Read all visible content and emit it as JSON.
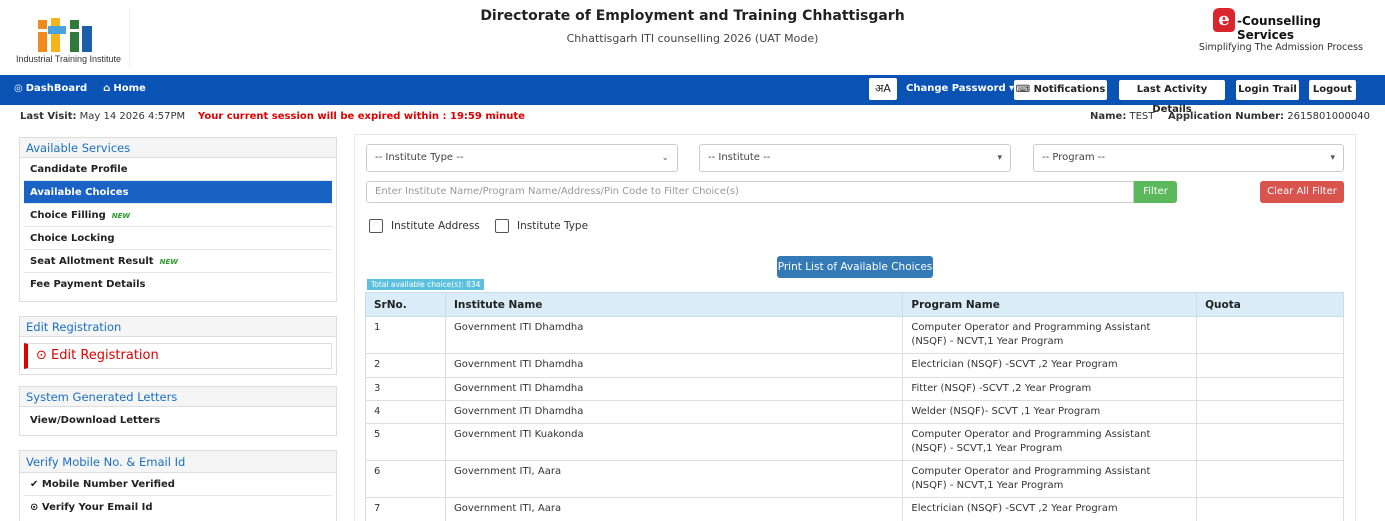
{
  "header": {
    "logo_text": "Industrial Training Institute",
    "title": "Directorate of Employment and Training Chhattisgarh",
    "subtitle": "Chhattisgarh ITI counselling 2026 (UAT Mode)",
    "brand_letter": "e",
    "brand_title": "-Counselling Services",
    "brand_tagline": "Simplifying The Admission Process"
  },
  "nav": {
    "dashboard": "DashBoard",
    "home": "Home",
    "lang": "अA",
    "change_password": "Change Password ▾",
    "notifications": "Notifications",
    "last_activity": "Last Activity Details",
    "login_trail": "Login Trail",
    "logout": "Logout"
  },
  "info": {
    "last_visit_label": "Last Visit:",
    "last_visit_value": " May 14 2026 4:57PM",
    "session_msg": "Your current session will be expired within : 19:59 minute",
    "name_label": "Name:",
    "name_value": " TEST",
    "app_label": "Application Number:",
    "app_value": " 2615801000040"
  },
  "sidebar": {
    "services_title": "Available Services",
    "services": [
      {
        "label": "Candidate Profile",
        "new": ""
      },
      {
        "label": "Available Choices",
        "new": ""
      },
      {
        "label": "Choice Filling",
        "new": "NEW"
      },
      {
        "label": "Choice Locking",
        "new": ""
      },
      {
        "label": "Seat Allotment Result",
        "new": "NEW"
      },
      {
        "label": "Fee Payment Details",
        "new": ""
      }
    ],
    "edit_title": "Edit Registration",
    "edit_link": "Edit Registration",
    "letters_title": "System Generated Letters",
    "letters_item": "View/Download Letters",
    "verify_title": "Verify Mobile No. & Email Id",
    "mobile_verified": "Mobile Number Verified",
    "verify_email": "Verify Your Email Id"
  },
  "filters": {
    "institute_type": "-- Institute Type --",
    "institute": "-- Institute --",
    "program": "-- Program --",
    "search_placeholder": "Enter Institute Name/Program Name/Address/Pin Code to Filter Choice(s)",
    "filter_btn": "Filter",
    "clear_btn": "Clear All Filter",
    "chk_address": "Institute Address",
    "chk_type": "Institute Type",
    "print_btn": "Print List of Available Choices",
    "total": "Total available choice(s): 834"
  },
  "table": {
    "headers": [
      "SrNo.",
      "Institute Name",
      "Program Name",
      "Quota"
    ],
    "rows": [
      [
        "1",
        "Government ITI Dhamdha",
        "Computer Operator and Programming Assistant (NSQF) - NCVT,1 Year Program",
        ""
      ],
      [
        "2",
        "Government ITI Dhamdha",
        "Electrician (NSQF) -SCVT ,2 Year Program",
        ""
      ],
      [
        "3",
        "Government ITI Dhamdha",
        "Fitter (NSQF) -SCVT ,2 Year Program",
        ""
      ],
      [
        "4",
        "Government ITI Dhamdha",
        "Welder (NSQF)- SCVT ,1 Year Program",
        ""
      ],
      [
        "5",
        "Government ITI Kuakonda",
        "Computer Operator and Programming Assistant (NSQF) - SCVT,1 Year Program",
        ""
      ],
      [
        "6",
        "Government ITI, Aara",
        "Computer Operator and Programming Assistant (NSQF) - NCVT,1 Year Program",
        ""
      ],
      [
        "7",
        "Government ITI, Aara",
        "Electrician (NSQF) -SCVT ,2 Year Program",
        ""
      ]
    ]
  },
  "colors": {
    "navbar": "#0a53b5",
    "active_item": "#1a62c4",
    "session_warning": "#e00000",
    "filter_green": "#5cb85c",
    "clear_red": "#d9534f",
    "print_blue": "#337ab7",
    "table_header": "#d9ecf7"
  }
}
